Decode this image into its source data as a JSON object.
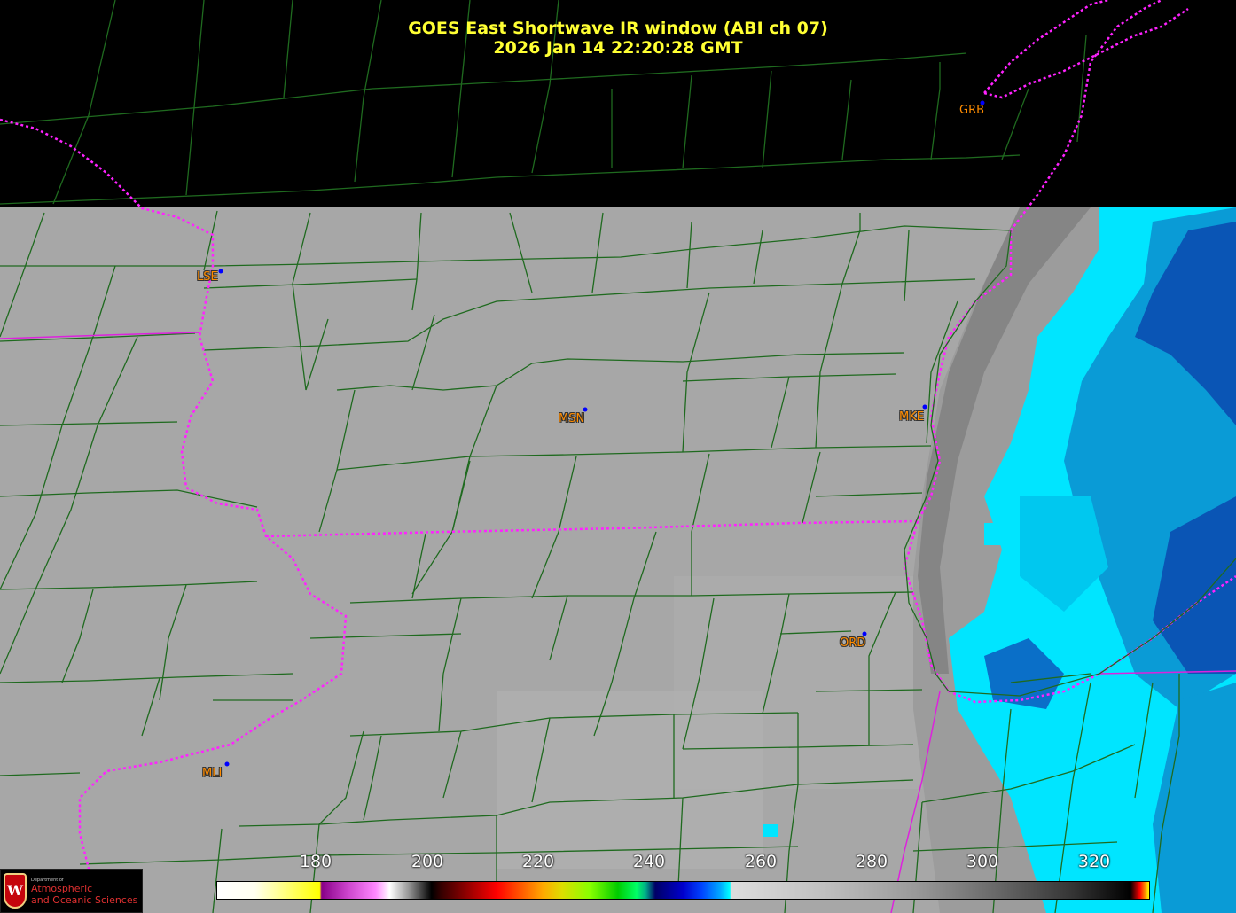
{
  "title_line1": "GOES East Shortwave IR window (ABI ch 07)",
  "title_line2": "2026 Jan 14  22:20:28 GMT",
  "stations": [
    {
      "code": "GRB",
      "id": "grb"
    },
    {
      "code": "LSE",
      "id": "lse"
    },
    {
      "code": "MSN",
      "id": "msn"
    },
    {
      "code": "MKE",
      "id": "mke"
    },
    {
      "code": "ORD",
      "id": "ord"
    },
    {
      "code": "MLI",
      "id": "mli"
    }
  ],
  "colorbar": {
    "ticks": [
      "180",
      "200",
      "220",
      "240",
      "260",
      "280",
      "300",
      "320"
    ]
  },
  "logo": {
    "dept_label": "Department of",
    "line1": "Atmospheric",
    "line2": "and Oceanic Sciences",
    "shield_letter": "W"
  },
  "colors": {
    "title": "#ffff33",
    "station_label": "#ff8c00",
    "county_lines": "#1f5f1f",
    "state_lines": "#ff00ff",
    "station_dot": "#0000ff"
  }
}
